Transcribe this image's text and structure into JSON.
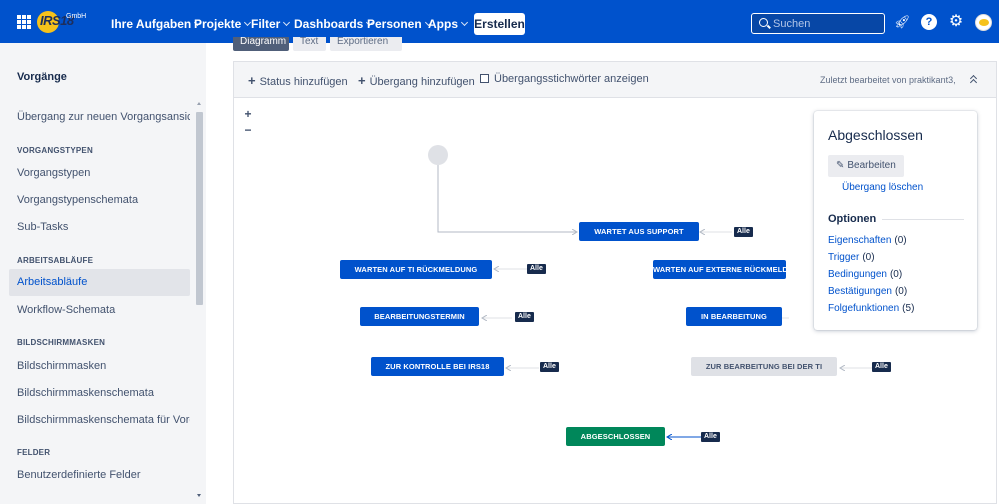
{
  "header": {
    "logo_text": "IRS18",
    "logo_sub": "GmbH",
    "nav": [
      {
        "label": "Ihre Aufgaben"
      },
      {
        "label": "Projekte"
      },
      {
        "label": "Filter"
      },
      {
        "label": "Dashboards"
      },
      {
        "label": "Personen"
      },
      {
        "label": "Apps"
      }
    ],
    "create_label": "Erstellen",
    "search_placeholder": "Suchen",
    "icons": [
      "apps-grid-icon",
      "rocket-icon",
      "help-icon",
      "gear-icon",
      "avatar"
    ]
  },
  "sidebar": {
    "title": "Vorgänge",
    "items": [
      {
        "label": "Übergang zur neuen Vorgangsansicht",
        "type": "link"
      },
      {
        "label": "VORGANGSTYPEN",
        "type": "heading"
      },
      {
        "label": "Vorgangstypen",
        "type": "link"
      },
      {
        "label": "Vorgangstypenschemata",
        "type": "link"
      },
      {
        "label": "Sub-Tasks",
        "type": "link"
      },
      {
        "label": "ARBEITSABLÄUFE",
        "type": "heading"
      },
      {
        "label": "Arbeitsabläufe",
        "type": "link",
        "active": true
      },
      {
        "label": "Workflow-Schemata",
        "type": "link"
      },
      {
        "label": "BILDSCHIRMMASKEN",
        "type": "heading"
      },
      {
        "label": "Bildschirmmasken",
        "type": "link"
      },
      {
        "label": "Bildschirmmaskenschemata",
        "type": "link"
      },
      {
        "label": "Bildschirmmaskenschemata für Vorga...",
        "type": "link"
      },
      {
        "label": "FELDER",
        "type": "heading"
      },
      {
        "label": "Benutzerdefinierte Felder",
        "type": "link"
      }
    ]
  },
  "main": {
    "tabs": [
      {
        "label": "Diagramm",
        "active": true
      },
      {
        "label": "Text",
        "active": false
      },
      {
        "label": "Exportieren",
        "active": false
      }
    ],
    "toolbar": {
      "add_status": "Status hinzufügen",
      "add_transition": "Übergang hinzufügen",
      "show_labels": "Übergangsstichwörter anzeigen",
      "last_edited": "Zuletzt bearbeitet von praktikant3,"
    },
    "zoom": {
      "in": "+",
      "out": "−"
    }
  },
  "workflow": {
    "statuses": [
      {
        "label": "WARTET AUS SUPPORT",
        "color": "#0052cc"
      },
      {
        "label": "WARTEN AUF TI RÜCKMELDUNG",
        "color": "#0052cc"
      },
      {
        "label": "WARTEN AUF EXTERNE RÜCKMELDUNG",
        "color": "#0052cc"
      },
      {
        "label": "BEARBEITUNGSTERMIN",
        "color": "#0052cc"
      },
      {
        "label": "IN BEARBEITUNG",
        "color": "#0052cc"
      },
      {
        "label": "ZUR KONTROLLE BEI IRS18",
        "color": "#0052cc"
      },
      {
        "label": "ZUR BEARBEITUNG BEI DER TI",
        "color": "#dfe1e6"
      },
      {
        "label": "ABGESCHLOSSEN",
        "color": "#00875a"
      }
    ],
    "all_label": "Alle"
  },
  "panel": {
    "title": "Abgeschlossen",
    "edit_label": "Bearbeiten",
    "delete_label": "Übergang löschen",
    "section_title": "Optionen",
    "options": [
      {
        "label": "Eigenschaften",
        "count": "(0)"
      },
      {
        "label": "Trigger",
        "count": "(0)"
      },
      {
        "label": "Bedingungen",
        "count": "(0)"
      },
      {
        "label": "Bestätigungen",
        "count": "(0)"
      },
      {
        "label": "Folgefunktionen",
        "count": "(5)"
      }
    ]
  }
}
